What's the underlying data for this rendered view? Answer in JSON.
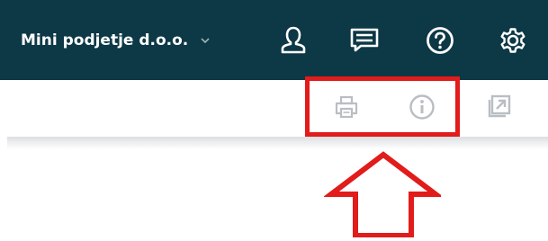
{
  "header": {
    "company_name": "Mini podjetje d.o.o.",
    "background_color": "#0d3846",
    "icons": [
      "chevron-down-icon",
      "user-icon",
      "message-icon",
      "help-icon",
      "settings-icon"
    ]
  },
  "toolbar": {
    "icons": [
      "print-icon",
      "info-icon",
      "open-external-icon"
    ],
    "icon_color": "#b9bec3"
  },
  "annotation": {
    "box_color": "#e21b1b",
    "arrow_color": "#e21b1b",
    "arrow_direction": "up"
  }
}
